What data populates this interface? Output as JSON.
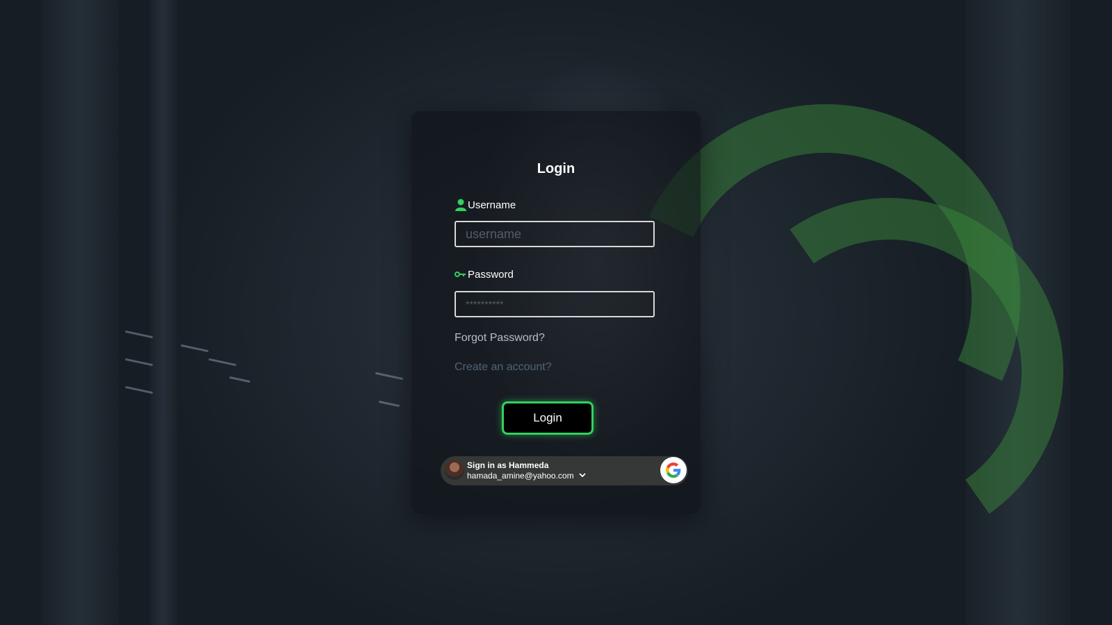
{
  "login_card": {
    "title": "Login",
    "username": {
      "label": "Username",
      "placeholder": "username",
      "value": "",
      "icon": "user-icon"
    },
    "password": {
      "label": "Password",
      "placeholder": "**********",
      "value": "",
      "icon": "key-icon"
    },
    "forgot_password_link": "Forgot Password?",
    "create_account_link": "Create an account?",
    "login_button": "Login"
  },
  "google_sign_in": {
    "prompt": "Sign in as Hammeda",
    "email": "hamada_amine@yahoo.com",
    "icons": [
      "avatar",
      "chevron-down-icon",
      "google-icon"
    ]
  },
  "colors": {
    "accent": "#33d15e",
    "card_background": "#0e1216",
    "create_link": "#4f6476",
    "forgot_link": "#b9bfc5"
  }
}
